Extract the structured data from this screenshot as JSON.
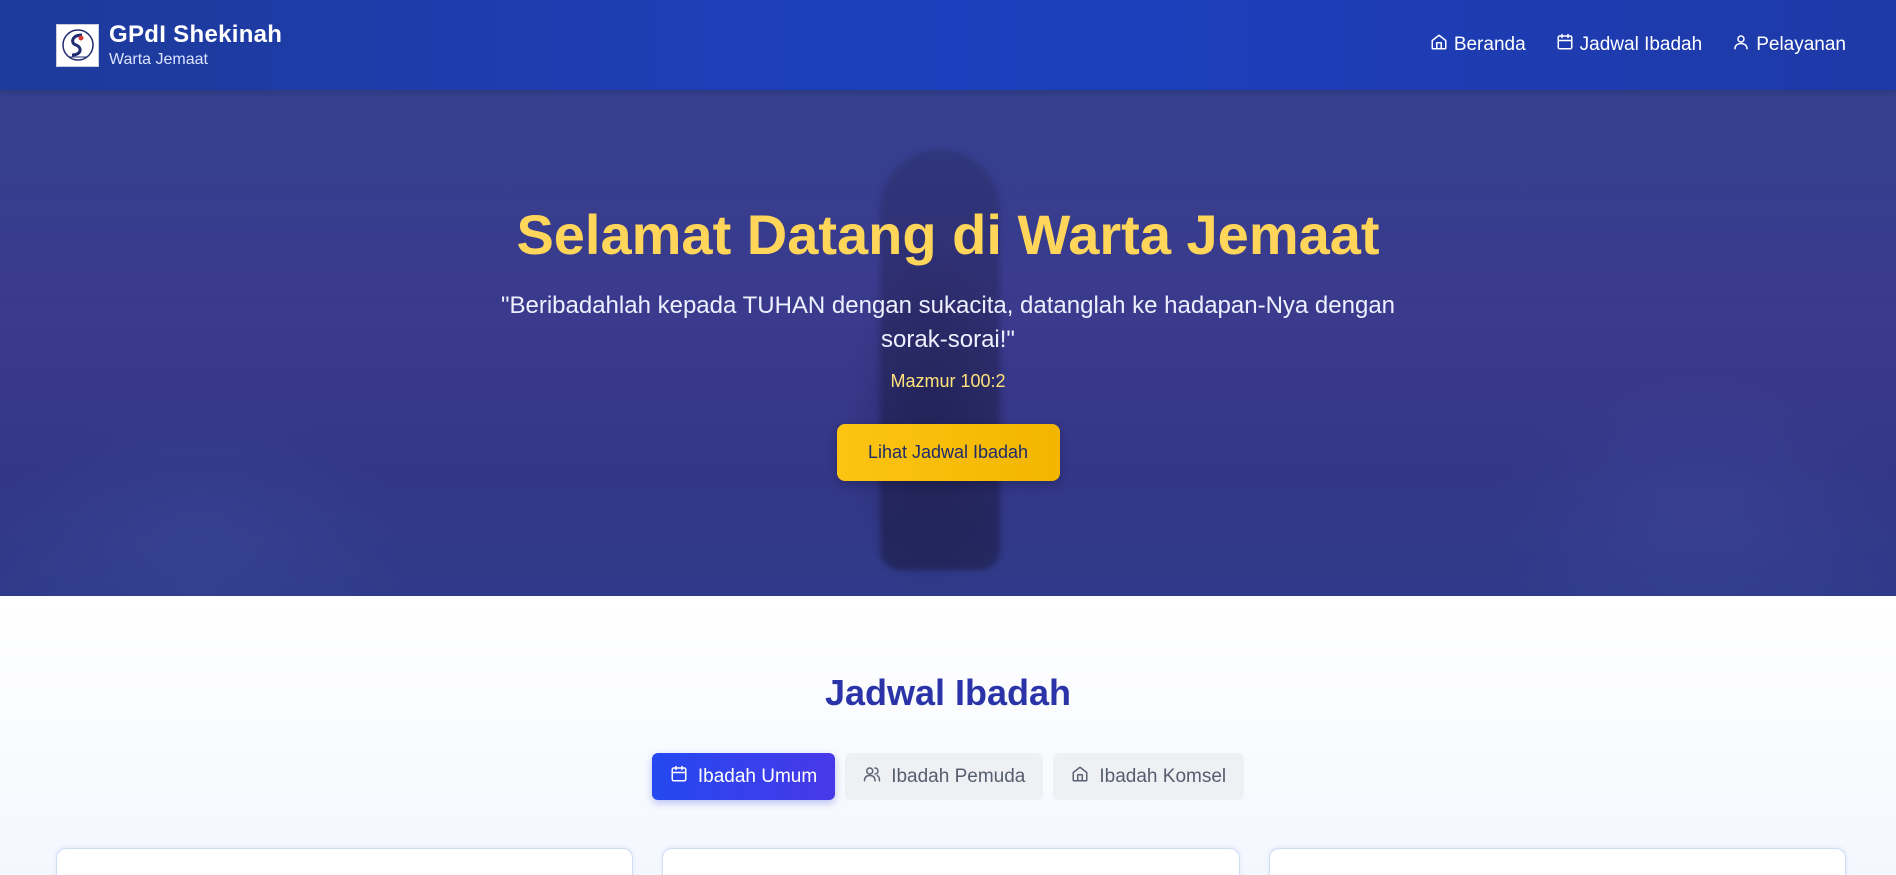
{
  "header": {
    "brand_title": "GPdI Shekinah",
    "brand_subtitle": "Warta Jemaat",
    "nav": [
      {
        "label": "Beranda",
        "icon": "home-icon"
      },
      {
        "label": "Jadwal Ibadah",
        "icon": "calendar-icon"
      },
      {
        "label": "Pelayanan",
        "icon": "user-icon"
      }
    ]
  },
  "hero": {
    "title": "Selamat Datang di Warta Jemaat",
    "quote": "\"Beribadahlah kepada TUHAN dengan sukacita, datanglah ke hadapan-Nya dengan sorak-sorai!\"",
    "reference": "Mazmur 100:2",
    "button_label": "Lihat Jadwal Ibadah"
  },
  "schedule": {
    "title": "Jadwal Ibadah",
    "tabs": [
      {
        "label": "Ibadah Umum",
        "icon": "calendar-icon",
        "active": true
      },
      {
        "label": "Ibadah Pemuda",
        "icon": "users-icon",
        "active": false
      },
      {
        "label": "Ibadah Komsel",
        "icon": "home-icon",
        "active": false
      }
    ]
  },
  "colors": {
    "header_bg": "#1d3fbf",
    "hero_title": "#ffd65a",
    "accent_button": "#fcc412",
    "section_title": "#2a34a8",
    "active_tab": "#2448f0"
  }
}
